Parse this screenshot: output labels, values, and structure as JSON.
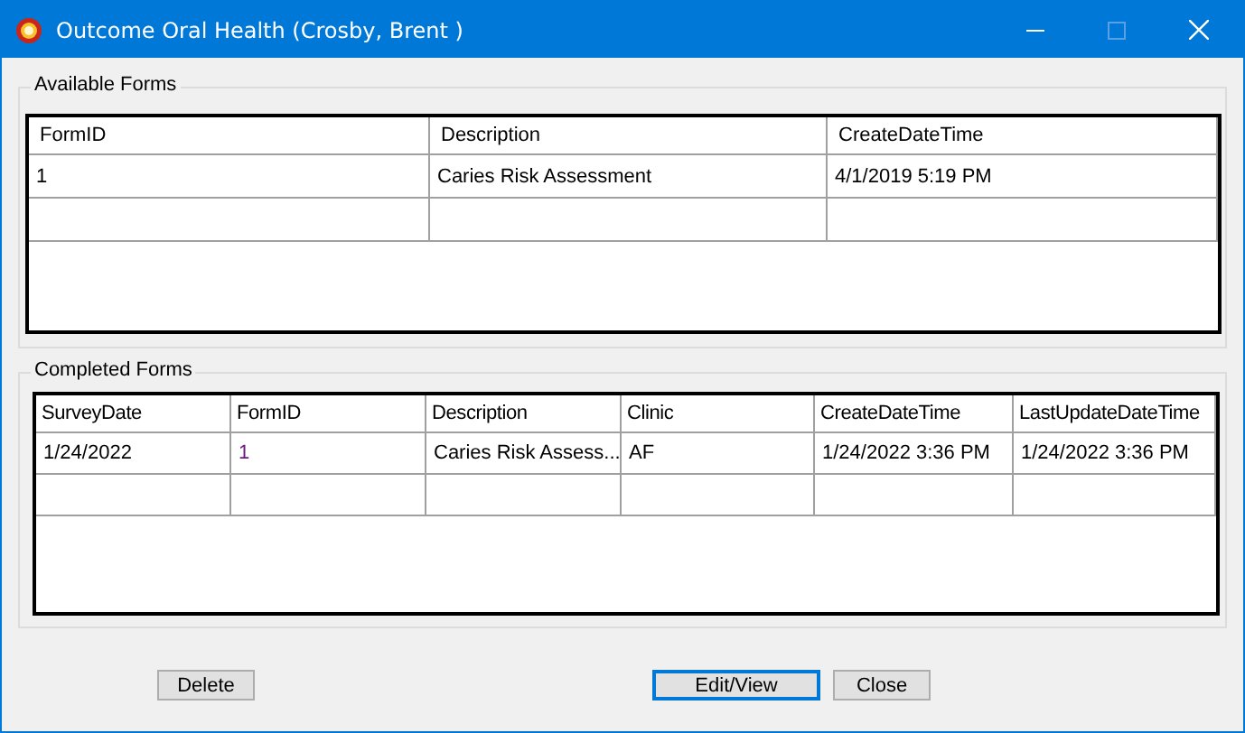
{
  "window": {
    "title": "Outcome Oral Health (Crosby, Brent )"
  },
  "available_forms": {
    "title": "Available Forms",
    "columns": [
      "FormID",
      "Description",
      "CreateDateTime"
    ],
    "rows": [
      [
        "1",
        "Caries Risk Assessment",
        "4/1/2019 5:19 PM"
      ]
    ]
  },
  "completed_forms": {
    "title": "Completed Forms",
    "columns": [
      "SurveyDate",
      "FormID",
      "Description",
      "Clinic",
      "CreateDateTime",
      "LastUpdateDateTime"
    ],
    "rows": [
      [
        "1/24/2022",
        "1",
        "Caries Risk Assess...",
        "AF",
        "1/24/2022 3:36 PM",
        "1/24/2022 3:36 PM"
      ]
    ]
  },
  "buttons": [
    {
      "label": "Delete",
      "focused": false
    },
    {
      "label": "Edit/View",
      "focused": true
    },
    {
      "label": "Close",
      "focused": false
    }
  ]
}
